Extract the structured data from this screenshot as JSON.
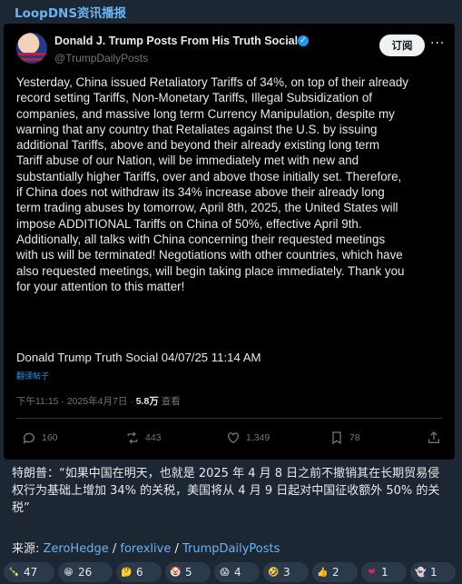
{
  "channel": {
    "title": "LoopDNS资讯播报"
  },
  "tweet": {
    "author_name": "Donald J. Trump Posts From His Truth Social",
    "handle": "@TrumpDailyPosts",
    "subscribe_label": "订阅",
    "more_label": "···",
    "body": "Yesterday, China issued Retaliatory Tariffs of 34%, on top of their already\nrecord setting Tariffs, Non-Monetary Tariffs, Illegal Subsidization of\ncompanies, and massive long term Currency Manipulation, despite my\nwarning that any country that Retaliates against the U.S. by issuing\nadditional Tariffs, above and beyond their already existing long term\nTariff abuse of our Nation, will be immediately met with new and\nsubstantially higher Tariffs, over and above those initially set. Therefore,\nif China does not withdraw its 34% increase above their already long\nterm trading abuses by tomorrow, April 8th, 2025, the United States will\nimpose ADDITIONAL Tariffs on China of 50%, effective April 9th.\nAdditionally, all talks with China concerning their requested meetings\nwith us will be terminated! Negotiations with other countries, which have\nalso requested meetings, will begin taking place immediately. Thank you\nfor your attention to this matter!",
    "signature": "Donald Trump Truth Social 04/07/25 11:14 AM",
    "translate_label": "翻译帖子",
    "time": "下午11:15 · 2025年4月7日 · ",
    "views_count": "5.8万",
    "views_label": " 查看",
    "actions": {
      "replies": "160",
      "retweets": "443",
      "likes": "1,349",
      "bookmarks": "78"
    }
  },
  "caption": "特朗普：“如果中国在明天，也就是 2025 年 4 月 8 日之前不撤销其在长期贸易侵权行为基础上增加 34% 的关税，美国将从 4 月 9 日起对中国征收额外 50% 的关税”",
  "sources": {
    "prefix": "来源: ",
    "links": [
      "ZeroHedge",
      "forexlive",
      "TrumpDailyPosts"
    ],
    "separator": " / "
  },
  "reactions": [
    {
      "icon": "bottle-icon",
      "glyph": "🍾",
      "count": "47",
      "color": "#3d8b3d"
    },
    {
      "icon": "grin-icon",
      "glyph": "😁",
      "count": "26",
      "color": "#f4c542"
    },
    {
      "icon": "thinking-icon",
      "glyph": "🤔",
      "count": "6",
      "color": "#f4c542"
    },
    {
      "icon": "clown-icon",
      "glyph": "🤡",
      "count": "5",
      "color": "#e6e6e6"
    },
    {
      "icon": "scream-icon",
      "glyph": "😱",
      "count": "4",
      "color": "#f4c542"
    },
    {
      "icon": "rofl-icon",
      "glyph": "🤣",
      "count": "3",
      "color": "#f4c542"
    },
    {
      "icon": "thumbs-up-icon",
      "glyph": "👍",
      "count": "2",
      "color": "#f4c542"
    },
    {
      "icon": "heart-icon",
      "glyph": "❤",
      "count": "1",
      "color": "#e0245e"
    },
    {
      "icon": "ghost-icon",
      "glyph": "👻",
      "count": "1",
      "color": "#eeeeee"
    }
  ]
}
